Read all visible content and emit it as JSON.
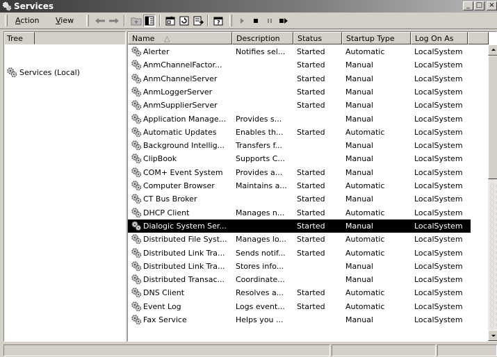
{
  "window": {
    "title": "Services",
    "controls": {
      "minimize": "_",
      "maximize": "□",
      "close": "×"
    }
  },
  "menu": [
    {
      "label": "Action",
      "hotkey": "A",
      "rest": "ction"
    },
    {
      "label": "View",
      "hotkey": "V",
      "rest": "iew"
    }
  ],
  "toolbar_icons": [
    "back-icon",
    "forward-icon",
    "up-folder-icon",
    "show-tree-icon",
    "properties-icon",
    "refresh-icon",
    "export-list-icon",
    "help-icon",
    "start-service-icon",
    "stop-service-icon",
    "pause-service-icon",
    "restart-service-icon"
  ],
  "tree": {
    "tab_label": "Tree",
    "node_label": "Services (Local)"
  },
  "list": {
    "columns": [
      "Name",
      "Description",
      "Status",
      "Startup Type",
      "Log On As"
    ],
    "sort_indicator": "△",
    "selected_index": 13,
    "rows": [
      {
        "name": "Alerter",
        "description": "Notifies sel...",
        "status": "Started",
        "startup": "Automatic",
        "logon": "LocalSystem"
      },
      {
        "name": "AnmChannelFactor...",
        "description": "",
        "status": "Started",
        "startup": "Manual",
        "logon": "LocalSystem"
      },
      {
        "name": "AnmChannelServer",
        "description": "",
        "status": "Started",
        "startup": "Manual",
        "logon": "LocalSystem"
      },
      {
        "name": "AnmLoggerServer",
        "description": "",
        "status": "Started",
        "startup": "Manual",
        "logon": "LocalSystem"
      },
      {
        "name": "AnmSupplierServer",
        "description": "",
        "status": "Started",
        "startup": "Manual",
        "logon": "LocalSystem"
      },
      {
        "name": "Application Manage...",
        "description": "Provides s...",
        "status": "",
        "startup": "Manual",
        "logon": "LocalSystem"
      },
      {
        "name": "Automatic Updates",
        "description": "Enables th...",
        "status": "Started",
        "startup": "Automatic",
        "logon": "LocalSystem"
      },
      {
        "name": "Background Intellig...",
        "description": "Transfers f...",
        "status": "",
        "startup": "Manual",
        "logon": "LocalSystem"
      },
      {
        "name": "ClipBook",
        "description": "Supports C...",
        "status": "",
        "startup": "Manual",
        "logon": "LocalSystem"
      },
      {
        "name": "COM+ Event System",
        "description": "Provides a...",
        "status": "Started",
        "startup": "Manual",
        "logon": "LocalSystem"
      },
      {
        "name": "Computer Browser",
        "description": "Maintains a...",
        "status": "Started",
        "startup": "Automatic",
        "logon": "LocalSystem"
      },
      {
        "name": "CT Bus Broker",
        "description": "",
        "status": "Started",
        "startup": "Manual",
        "logon": "LocalSystem"
      },
      {
        "name": "DHCP Client",
        "description": "Manages n...",
        "status": "Started",
        "startup": "Automatic",
        "logon": "LocalSystem"
      },
      {
        "name": "Dialogic System Ser...",
        "description": "",
        "status": "Started",
        "startup": "Manual",
        "logon": "LocalSystem"
      },
      {
        "name": "Distributed File Syst...",
        "description": "Manages lo...",
        "status": "Started",
        "startup": "Automatic",
        "logon": "LocalSystem"
      },
      {
        "name": "Distributed Link Tra...",
        "description": "Sends notif...",
        "status": "Started",
        "startup": "Automatic",
        "logon": "LocalSystem"
      },
      {
        "name": "Distributed Link Tra...",
        "description": "Stores info...",
        "status": "",
        "startup": "Manual",
        "logon": "LocalSystem"
      },
      {
        "name": "Distributed Transac...",
        "description": "Coordinate...",
        "status": "",
        "startup": "Manual",
        "logon": "LocalSystem"
      },
      {
        "name": "DNS Client",
        "description": "Resolves a...",
        "status": "Started",
        "startup": "Automatic",
        "logon": "LocalSystem"
      },
      {
        "name": "Event Log",
        "description": "Logs event...",
        "status": "Started",
        "startup": "Automatic",
        "logon": "LocalSystem"
      },
      {
        "name": "Fax Service",
        "description": "Helps you ...",
        "status": "",
        "startup": "Manual",
        "logon": "LocalSystem"
      }
    ]
  },
  "colors": {
    "window_face": "#d4d0c8",
    "selection": "#000000",
    "title_gradient_start": "#3a3a3a"
  }
}
